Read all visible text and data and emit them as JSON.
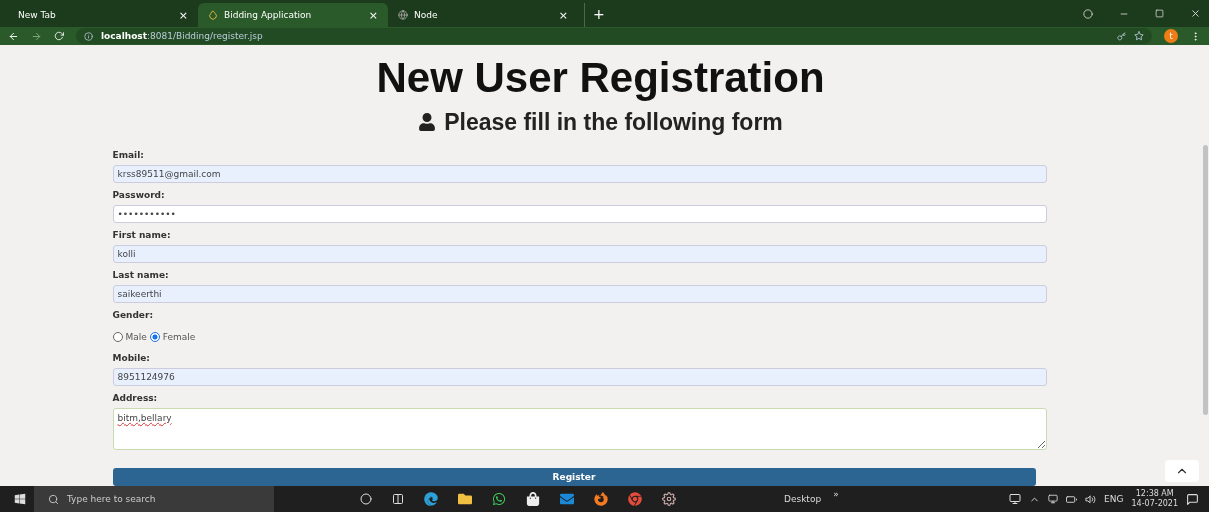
{
  "browser": {
    "tabs": [
      {
        "title": "New Tab",
        "close": "×",
        "selected": false
      },
      {
        "title": "Bidding Application",
        "close": "×",
        "selected": true
      },
      {
        "title": "Node",
        "close": "×",
        "selected": false
      }
    ],
    "new_tab": "+",
    "url_host": "localhost",
    "url_path": ":8081/Bidding/register.jsp",
    "profile": "t"
  },
  "page": {
    "title": "New User Registration",
    "subtitle": "Please fill in the following form",
    "fields": [
      {
        "kind": "input",
        "label": "Email:",
        "value": "krss89511@gmail.com",
        "autofilled": true
      },
      {
        "kind": "input",
        "label": "Password:",
        "value": "•••••••••••",
        "autofilled": false
      },
      {
        "kind": "input",
        "label": "First name:",
        "value": "kolli",
        "autofilled": true
      },
      {
        "kind": "input",
        "label": "Last name:",
        "value": "saikeerthi",
        "autofilled": true
      },
      {
        "kind": "radio",
        "label": "Gender:",
        "options": [
          {
            "label": "Male",
            "selected": false
          },
          {
            "label": "Female",
            "selected": true
          }
        ]
      },
      {
        "kind": "input",
        "label": "Mobile:",
        "value": "8951124976",
        "autofilled": true
      },
      {
        "kind": "textarea",
        "label": "Address:",
        "value": "bitm,bellary",
        "autofilled": false
      }
    ],
    "submit": "Register"
  },
  "taskbar": {
    "search_placeholder": "Type here to search",
    "desktop": "Desktop",
    "chevron": "»",
    "language": "ENG",
    "time": "12:38 AM",
    "date": "14-07-2021"
  }
}
